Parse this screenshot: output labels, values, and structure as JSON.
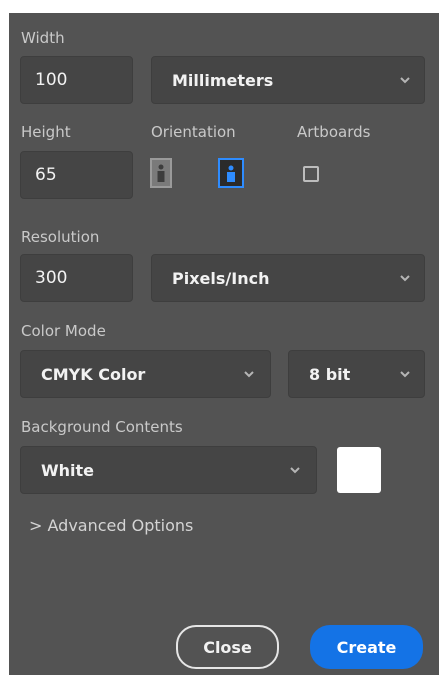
{
  "width": {
    "label": "Width",
    "value": "100",
    "unit": "Millimeters"
  },
  "height": {
    "label": "Height",
    "value": "65"
  },
  "orientation": {
    "label": "Orientation",
    "selected": "landscape"
  },
  "artboards": {
    "label": "Artboards",
    "checked": false
  },
  "resolution": {
    "label": "Resolution",
    "value": "300",
    "unit": "Pixels/Inch"
  },
  "color_mode": {
    "label": "Color Mode",
    "mode": "CMYK Color",
    "bit_depth": "8 bit"
  },
  "background": {
    "label": "Background Contents",
    "value": "White",
    "swatch_color": "#ffffff"
  },
  "advanced": {
    "label": "> Advanced Options"
  },
  "buttons": {
    "close": "Close",
    "create": "Create"
  },
  "colors": {
    "panel": "#535353",
    "field": "#454545",
    "accent": "#1473e6"
  },
  "icons": [
    "chevron-down-icon",
    "portrait-icon",
    "landscape-icon"
  ]
}
